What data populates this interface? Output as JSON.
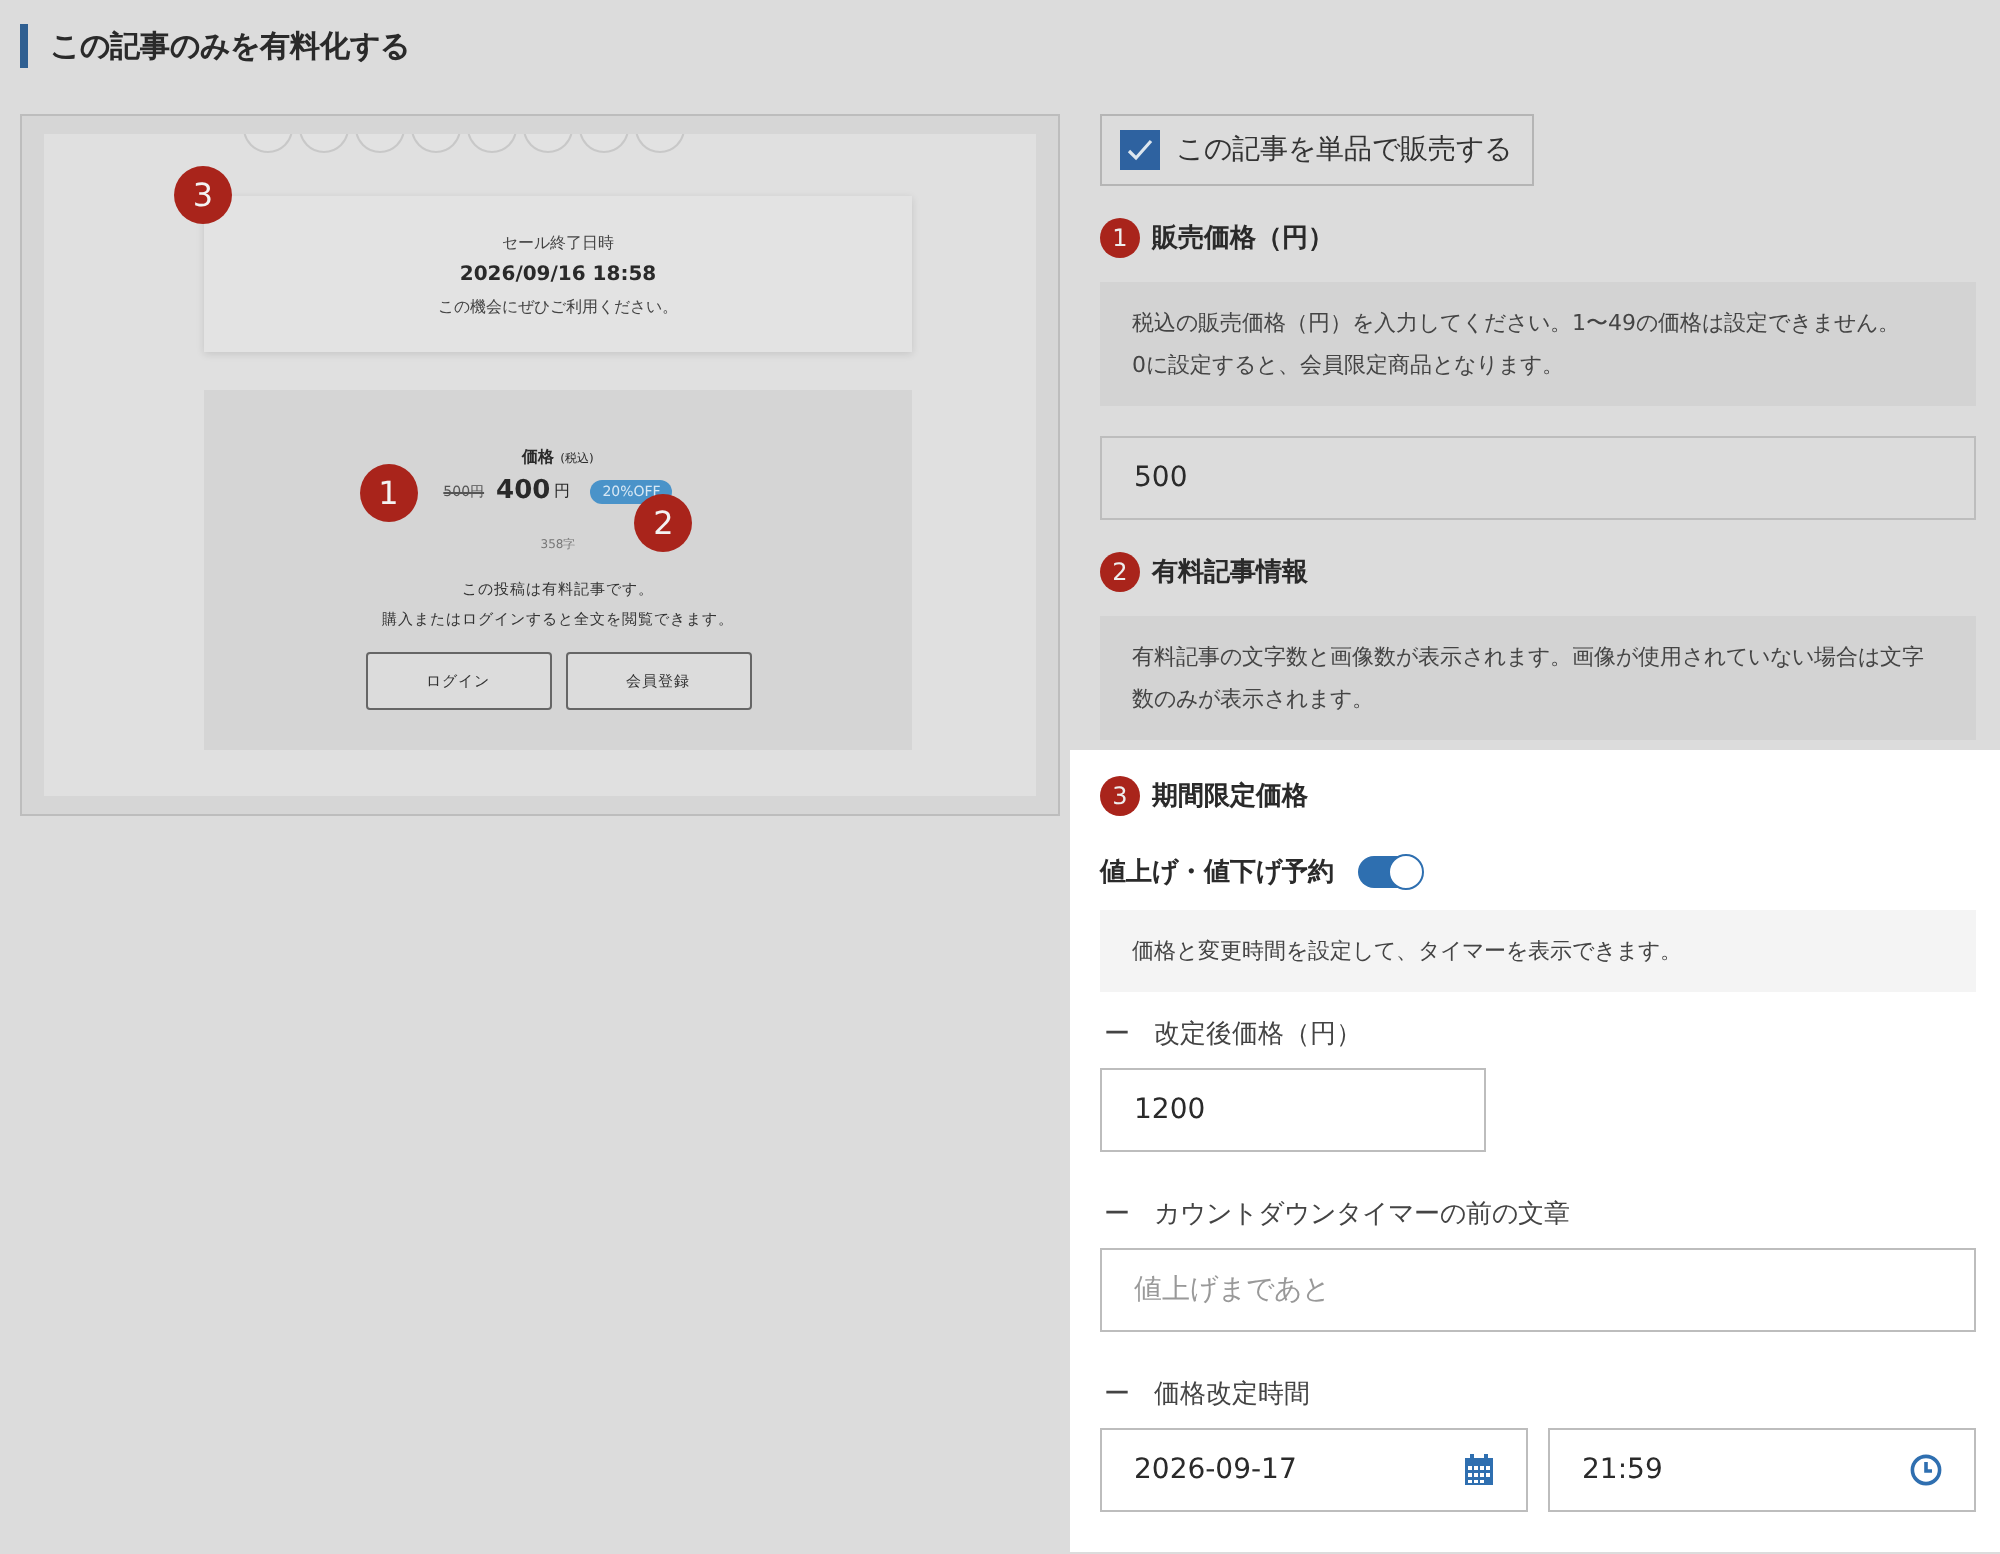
{
  "title": "この記事のみを有料化する",
  "preview": {
    "sale_box": {
      "badge": "3",
      "label": "セール終了日時",
      "date": "2026/09/16 18:58",
      "note": "この機会にぜひご利用ください。"
    },
    "price_box": {
      "label": "価格",
      "label_note": "(税込)",
      "badge_1": "1",
      "old_price": "500円",
      "price": "400",
      "currency": "円",
      "discount": "20%OFF",
      "char_count": "358字",
      "badge_2": "2",
      "lines": [
        "この投稿は有料記事です。",
        "購入またはログインすると全文を閲覧できます。"
      ],
      "buttons": [
        "ログイン",
        "会員登録"
      ]
    }
  },
  "sell_single": {
    "label": "この記事を単品で販売する",
    "checked": true
  },
  "price_section": {
    "badge": "1",
    "heading": "販売価格（円）",
    "help": [
      "税込の販売価格（円）を入力してください。1〜49の価格は設定できません。",
      "0に設定すると、会員限定商品となります。"
    ],
    "value": "500"
  },
  "info_section": {
    "badge": "2",
    "heading": "有料記事情報",
    "help": "有料記事の文字数と画像数が表示されます。画像が使用されていない場合は文字数のみが表示されます。"
  },
  "limited_section": {
    "badge": "3",
    "heading": "期間限定価格",
    "toggle": {
      "label": "値上げ・値下げ予約",
      "on": true
    },
    "help": "価格と変更時間を設定して、タイマーを表示できます。",
    "fields": [
      {
        "kind": "short",
        "dash": "ー",
        "label": "改定後価格（円）",
        "value": "1200"
      },
      {
        "kind": "text",
        "dash": "ー",
        "label": "カウントダウンタイマーの前の文章",
        "placeholder": "値上げまであと"
      },
      {
        "kind": "datetime",
        "dash": "ー",
        "label": "価格改定時間",
        "date": "2026-09-17",
        "time": "21:59"
      }
    ]
  }
}
